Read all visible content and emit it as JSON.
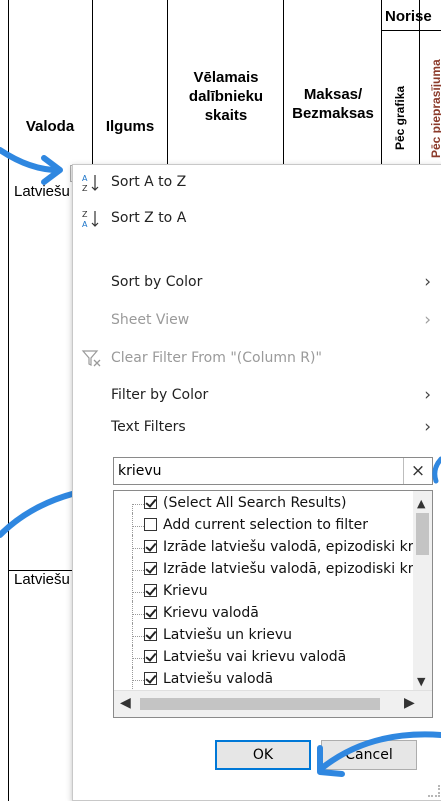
{
  "sheet": {
    "group_header": "Norise",
    "columns": [
      {
        "label": "Valoda"
      },
      {
        "label": "Ilgums"
      },
      {
        "label": "Vēlamais dalībnieku skaits"
      },
      {
        "label": "Maksas/ Bezmaksas"
      },
      {
        "label": "Pēc grafika"
      },
      {
        "label": "Pēc pieprasījuma"
      }
    ],
    "cells": [
      "Latviešu",
      "Latviešu"
    ]
  },
  "menu": {
    "sort_az": "Sort A to Z",
    "sort_za": "Sort Z to A",
    "sort_by_color": "Sort by Color",
    "sheet_view": "Sheet View",
    "clear_filter": "Clear Filter From \"(Column R)\"",
    "filter_by_color": "Filter by Color",
    "text_filters": "Text Filters",
    "search_value": "krievu",
    "clear_search_icon": "×",
    "chevron": "›",
    "items": [
      {
        "label": "(Select All Search Results)",
        "checked": true
      },
      {
        "label": "Add current selection to filter",
        "checked": false
      },
      {
        "label": "Izrāde latviešu valodā, epizodiski krievu",
        "checked": true
      },
      {
        "label": "Izrāde latviešu valodā, epizodiski krievu",
        "checked": true
      },
      {
        "label": "Krievu",
        "checked": true
      },
      {
        "label": "Krievu valodā",
        "checked": true
      },
      {
        "label": "Latviešu un krievu",
        "checked": true
      },
      {
        "label": "Latviešu vai  krievu valodā",
        "checked": true
      },
      {
        "label": "Latviešu valodā",
        "checked": true
      }
    ],
    "ok_label": "OK",
    "cancel_label": "Cancel"
  },
  "colors": {
    "annotation_arrow": "#2f87e0",
    "ok_focus_border": "#0078d7"
  }
}
